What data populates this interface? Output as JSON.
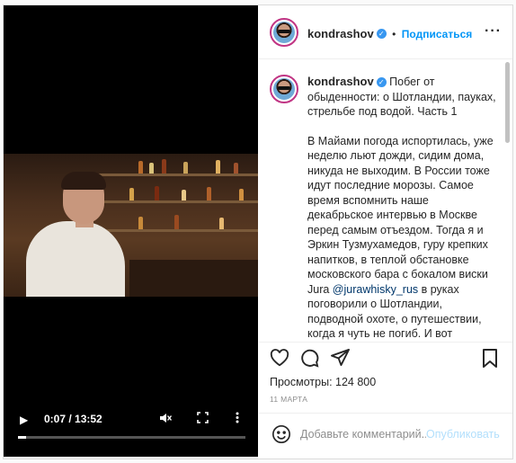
{
  "video": {
    "time_label": "0:07 / 13:52",
    "progress": 0.035,
    "play_icon": "play-icon",
    "mute_icon": "muted-icon",
    "fullscreen_icon": "fullscreen-icon",
    "more_icon": "more-vert-icon"
  },
  "header": {
    "username": "kondrashov",
    "separator": "•",
    "follow_label": "Подписаться",
    "more_label": "···"
  },
  "caption": {
    "username": "kondrashov",
    "title": "Побег от обыденности: о Шотландии, пауках, стрельбе под водой. Часть 1",
    "body_before_link": "В Майами погода испортилась, уже неделю льют дожди, сидим дома, никуда не выходим. В России тоже идут последние морозы. Самое время вспомнить наше декабрьское интервью в Москве перед самым отъездом. Тогда я и Эркин Тузмухамедов, гуру крепких напитков, в теплой обстановке московского бара с бокалом виски Jura ",
    "link": "@jurawhisky_rus",
    "body_after_link": " в руках поговорили о Шотландии, подводной охоте, о путешествии, когда я чуть не погиб. И вот"
  },
  "stats": {
    "views": "Просмотры: 124 800",
    "date": "11 МАРТА"
  },
  "comment": {
    "placeholder": "Добавьте комментарий...",
    "publish_label": "Опубликовать"
  },
  "colors": {
    "accent": "#0095f6",
    "text": "#262626",
    "muted": "#8e8e8e",
    "publish_disabled": "#b2dffc"
  }
}
